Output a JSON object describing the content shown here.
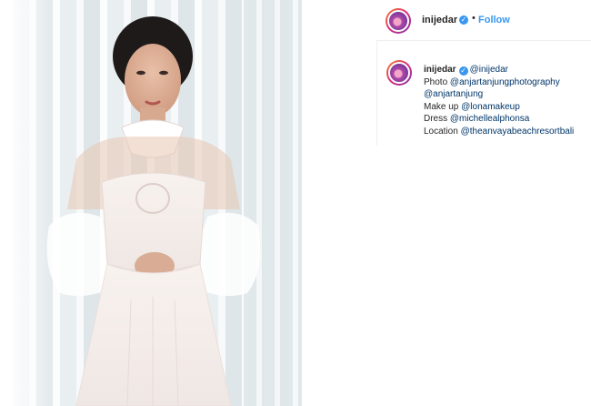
{
  "post": {
    "username": "inijedar",
    "follow_label": "Follow",
    "separator": "•",
    "verified_icon": "✓"
  },
  "caption": {
    "username": "inijedar",
    "mention_owner": "@inijedar",
    "line1_label": "Photo ",
    "line1_link": "@anjartanjungphotography",
    "line2_link": "@anjartanjung",
    "line3_label": "Make up ",
    "line3_link": "@lonamakeup",
    "line4_label": "Dress ",
    "line4_link": "@michellealphonsa",
    "line5_label": "Location ",
    "line5_link": "@theanvayabeachresortbali"
  },
  "colors": {
    "link": "#003569",
    "follow": "#3897f0",
    "verified": "#3897f0"
  }
}
